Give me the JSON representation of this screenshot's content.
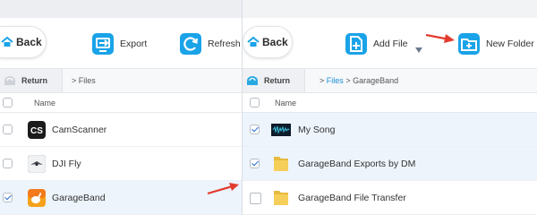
{
  "left": {
    "back_label": "Back",
    "tools": [
      {
        "label": "Export",
        "icon": "export-icon"
      },
      {
        "label": "Refresh",
        "icon": "refresh-icon"
      }
    ],
    "return_label": "Return",
    "breadcrumb": {
      "sep": ">",
      "current": "Files"
    },
    "column_name": "Name",
    "rows": [
      {
        "name": "CamScanner",
        "icon": "camscanner-app-icon",
        "checked": false
      },
      {
        "name": "DJI Fly",
        "icon": "dji-fly-app-icon",
        "checked": false
      },
      {
        "name": "GarageBand",
        "icon": "garageband-app-icon",
        "checked": true
      }
    ]
  },
  "right": {
    "back_label": "Back",
    "tools": [
      {
        "label": "Add File",
        "icon": "add-file-icon"
      },
      {
        "label": "New Folder",
        "icon": "new-folder-icon"
      }
    ],
    "return_label": "Return",
    "breadcrumb": {
      "link": "Files",
      "sep": ">",
      "current": "GarageBand"
    },
    "column_name": "Name",
    "rows": [
      {
        "name": "My Song",
        "icon": "audio-file-thumbnail",
        "checked": true
      },
      {
        "name": "GarageBand Exports by DM",
        "icon": "folder-icon",
        "checked": true
      },
      {
        "name": "GarageBand File Transfer",
        "icon": "folder-icon",
        "checked": false
      }
    ]
  },
  "colors": {
    "accent": "#1aa3e8",
    "annotation_arrow": "#e23b2e",
    "link": "#1a8fd6",
    "selected_row": "#edf4fc"
  }
}
